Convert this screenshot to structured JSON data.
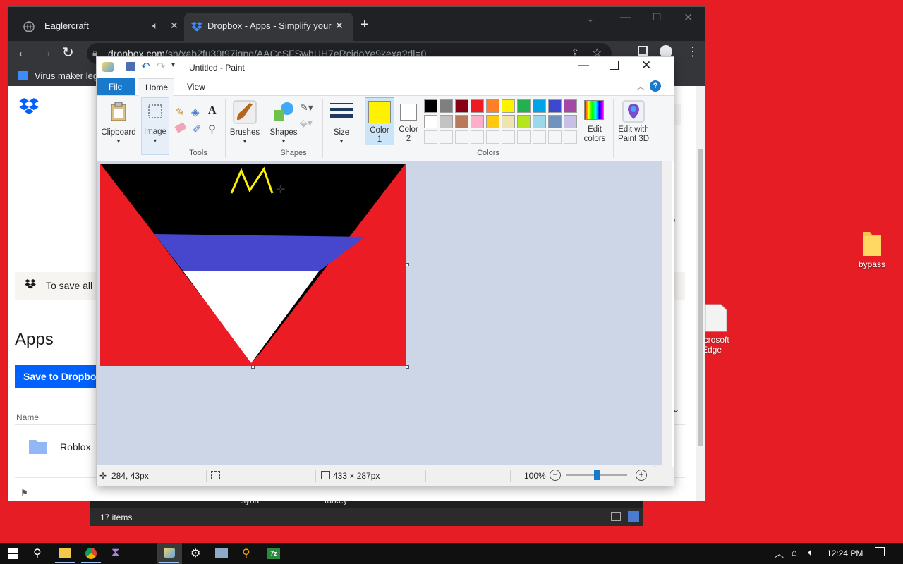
{
  "desktop": {
    "icons": [
      {
        "label": "bypass"
      },
      {
        "label": "icrosoft\nEdge"
      }
    ]
  },
  "explorer_bg": {
    "file_names": [
      "syria",
      "turkey"
    ],
    "item_count": "17 items"
  },
  "chrome": {
    "tabs": [
      {
        "title": "Eaglercraft",
        "active": false
      },
      {
        "title": "Dropbox - Apps - Simplify your l",
        "active": true
      }
    ],
    "url_host": "dropbox.com",
    "url_path": "/sh/xab2fu30t97iqpg/AACcSFSwhUH7eRcjdoYe9kexa?dl=0",
    "bookmark": "Virus maker legit",
    "page": {
      "banner_text": "To save all",
      "heading": "Apps",
      "save_button": "Save to Dropbox",
      "column_name": "Name",
      "folder_name": "Roblox",
      "partial_right_button": "up",
      "partial_right_text": "ute"
    }
  },
  "paint": {
    "window_title": "Untitled - Paint",
    "tabs": [
      "File",
      "Home",
      "View"
    ],
    "ribbon": {
      "clipboard": "Clipboard",
      "image": "Image",
      "tools_group": "Tools",
      "brushes": "Brushes",
      "shapes": "Shapes",
      "shapes_group": "Shapes",
      "size": "Size",
      "color1": "Color\n1",
      "color2": "Color\n2",
      "colors_group": "Colors",
      "edit_colors": "Edit\ncolors",
      "edit_paint3d": "Edit with\nPaint 3D"
    },
    "color1_value": "#fff200",
    "color2_value": "#ffffff",
    "palette_row1": [
      "#000000",
      "#7f7f7f",
      "#880015",
      "#ed1c24",
      "#ff7f27",
      "#fff200",
      "#22b14c",
      "#00a2e8",
      "#3f48cc",
      "#a349a4"
    ],
    "palette_row2": [
      "#ffffff",
      "#c3c3c3",
      "#b97a57",
      "#ffaec9",
      "#ffc90e",
      "#efe4b0",
      "#b5e61d",
      "#99d9ea",
      "#7092be",
      "#c8bfe7"
    ],
    "canvas": {
      "drawn_letter": "M",
      "colors": {
        "red": "#ec1c24",
        "black": "#000000",
        "blue": "#4647cc",
        "white": "#ffffff",
        "letter": "#fff200"
      }
    },
    "status": {
      "cursor_pos": "284, 43px",
      "image_size": "433 × 287px",
      "zoom": "100%",
      "zoom_level": 0.5
    }
  },
  "taskbar": {
    "time": "12:24 PM"
  }
}
